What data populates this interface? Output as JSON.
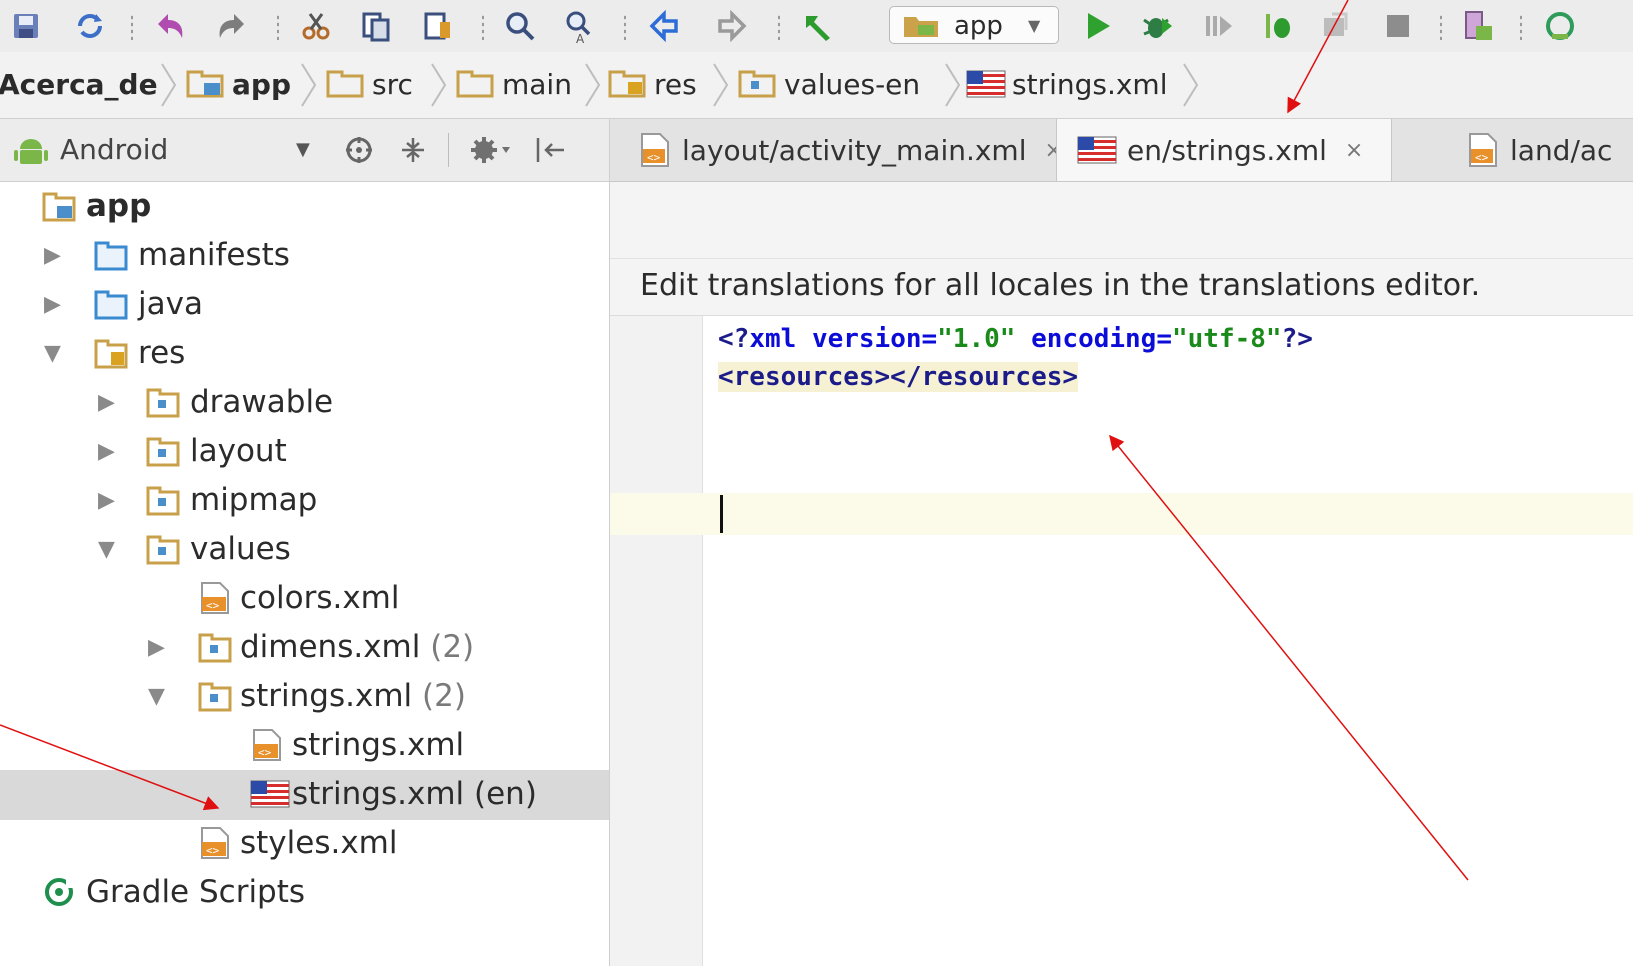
{
  "toolbar": {
    "run_config_label": "app",
    "icons": [
      "save-icon",
      "sync-icon",
      "undo-icon",
      "redo-icon",
      "cut-icon",
      "copy-icon",
      "paste-icon",
      "find-icon",
      "replace-icon",
      "back-icon",
      "forward-icon",
      "make-project-icon",
      "run-icon",
      "debug-icon",
      "attach-debugger-icon",
      "profile-icon",
      "gradle-sync-icon",
      "stop-icon",
      "avd-manager-icon",
      "sdk-manager-icon"
    ],
    "colors": {
      "run": "#2ea12e",
      "undo": "#b04bb0",
      "back": "#2d6cd6"
    }
  },
  "breadcrumb": {
    "items": [
      {
        "label": "Acerca_de",
        "icon": "none"
      },
      {
        "label": "app",
        "icon": "module-folder-icon"
      },
      {
        "label": "src",
        "icon": "folder-icon"
      },
      {
        "label": "main",
        "icon": "folder-icon"
      },
      {
        "label": "res",
        "icon": "res-folder-icon"
      },
      {
        "label": "values-en",
        "icon": "package-folder-icon"
      },
      {
        "label": "strings.xml",
        "icon": "us-flag-icon"
      }
    ]
  },
  "project_panel": {
    "view_selector": "Android",
    "tree": [
      {
        "label": "app",
        "count": "",
        "expanded": true
      },
      {
        "label": "manifests",
        "count": ""
      },
      {
        "label": "java",
        "count": ""
      },
      {
        "label": "res",
        "count": ""
      },
      {
        "label": "drawable",
        "count": ""
      },
      {
        "label": "layout",
        "count": ""
      },
      {
        "label": "mipmap",
        "count": ""
      },
      {
        "label": "values",
        "count": ""
      },
      {
        "label": "colors.xml",
        "count": ""
      },
      {
        "label": "dimens.xml",
        "count": "(2)"
      },
      {
        "label": "strings.xml",
        "count": "(2)"
      },
      {
        "label": "strings.xml",
        "count": ""
      },
      {
        "label": "strings.xml (en)",
        "count": "",
        "selected": true
      },
      {
        "label": "styles.xml",
        "count": ""
      },
      {
        "label": "Gradle Scripts",
        "count": ""
      }
    ]
  },
  "editor": {
    "tabs": [
      {
        "label": "layout/activity_main.xml",
        "close": "×",
        "active": false
      },
      {
        "label": "en/strings.xml",
        "close": "×",
        "active": true
      },
      {
        "label": "land/ac",
        "close": "",
        "active": false
      }
    ],
    "notification": "Edit translations for all locales in the translations editor.",
    "code": {
      "l1_open": "<?",
      "l1_xml": "xml ",
      "l1_attr1": "version",
      "l1_eq1": "=",
      "l1_val1": "\"1.0\"",
      "l1_sp": " ",
      "l1_attr2": "encoding",
      "l1_eq2": "=",
      "l1_val2": "\"utf-8\"",
      "l1_close": "?>",
      "l2": "<resources></resources>"
    },
    "code_colors": {
      "keyword": "#0c0cd8",
      "attr": "#0c0cd8",
      "string": "#1a8a1a",
      "tag": "#1b1b8a",
      "punct": "#000000"
    }
  },
  "annotation_color": "#e01010"
}
